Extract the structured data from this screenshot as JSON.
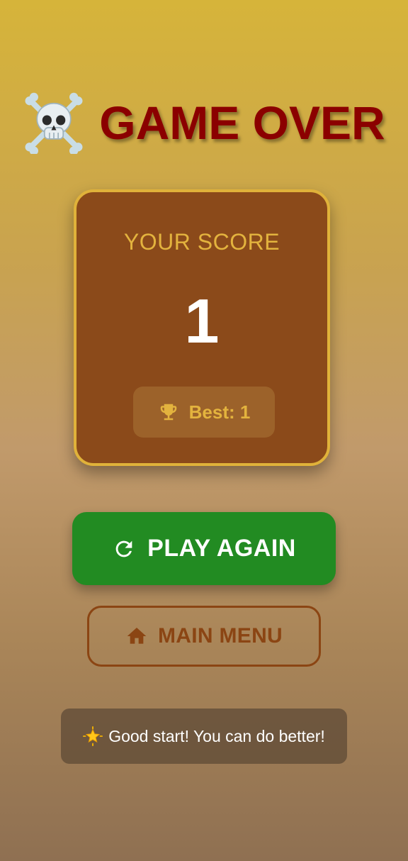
{
  "title": {
    "icon": "skull-and-crossbones-icon",
    "text": "GAME OVER",
    "color": "#8b0000"
  },
  "score_card": {
    "label": "YOUR SCORE",
    "score": "1",
    "best_icon": "trophy-icon",
    "best_text": "Best: 1",
    "accent_color": "#e3b33e",
    "background_color": "#8b4a1a"
  },
  "actions": {
    "play_again": {
      "icon": "refresh-icon",
      "label": "PLAY AGAIN",
      "color": "#228b22"
    },
    "main_menu": {
      "icon": "home-icon",
      "label": "MAIN MENU",
      "color": "#8b4513"
    }
  },
  "message": {
    "icon": "glowing-star-icon",
    "text": "Good start! You can do better!"
  }
}
